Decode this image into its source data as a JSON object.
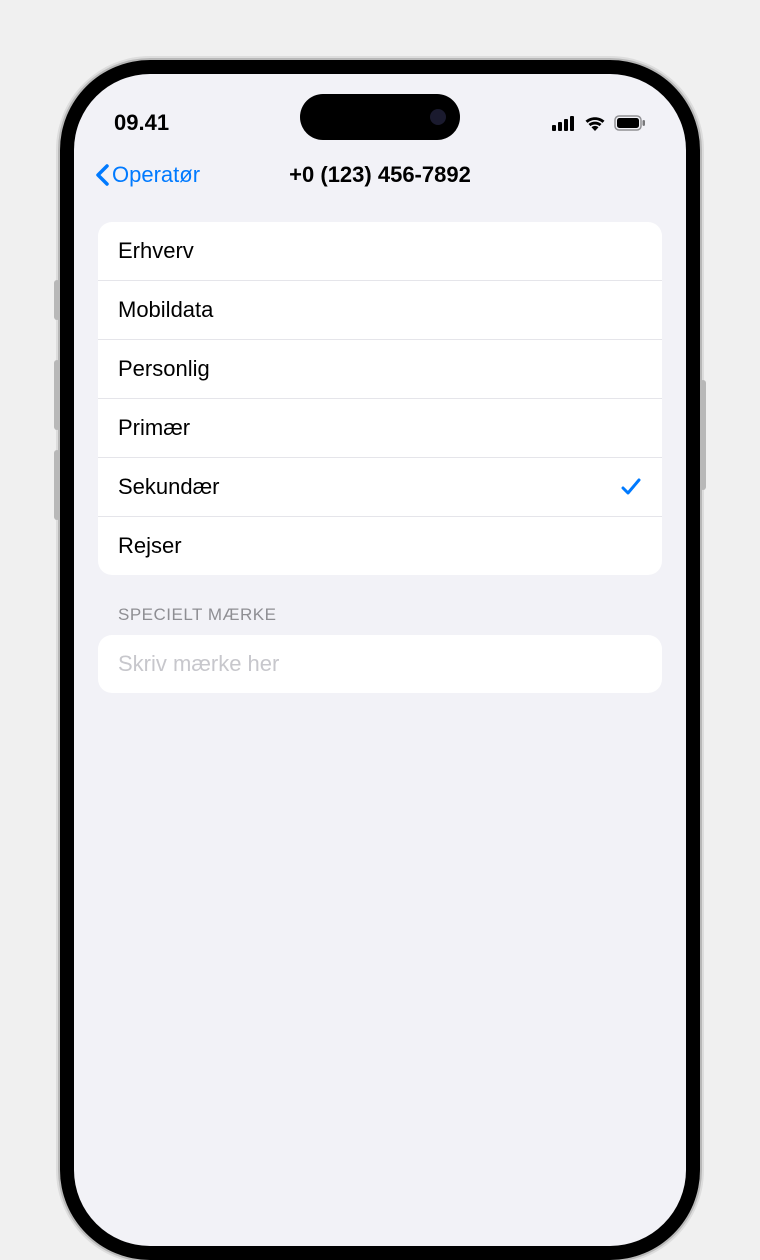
{
  "status_bar": {
    "time": "09.41"
  },
  "nav": {
    "back_label": "Operatør",
    "title": "+0 (123) 456-7892"
  },
  "labels": {
    "items": [
      {
        "label": "Erhverv",
        "selected": false
      },
      {
        "label": "Mobildata",
        "selected": false
      },
      {
        "label": "Personlig",
        "selected": false
      },
      {
        "label": "Primær",
        "selected": false
      },
      {
        "label": "Sekundær",
        "selected": true
      },
      {
        "label": "Rejser",
        "selected": false
      }
    ]
  },
  "custom_label": {
    "header": "Specielt mærke",
    "placeholder": "Skriv mærke her",
    "value": ""
  }
}
